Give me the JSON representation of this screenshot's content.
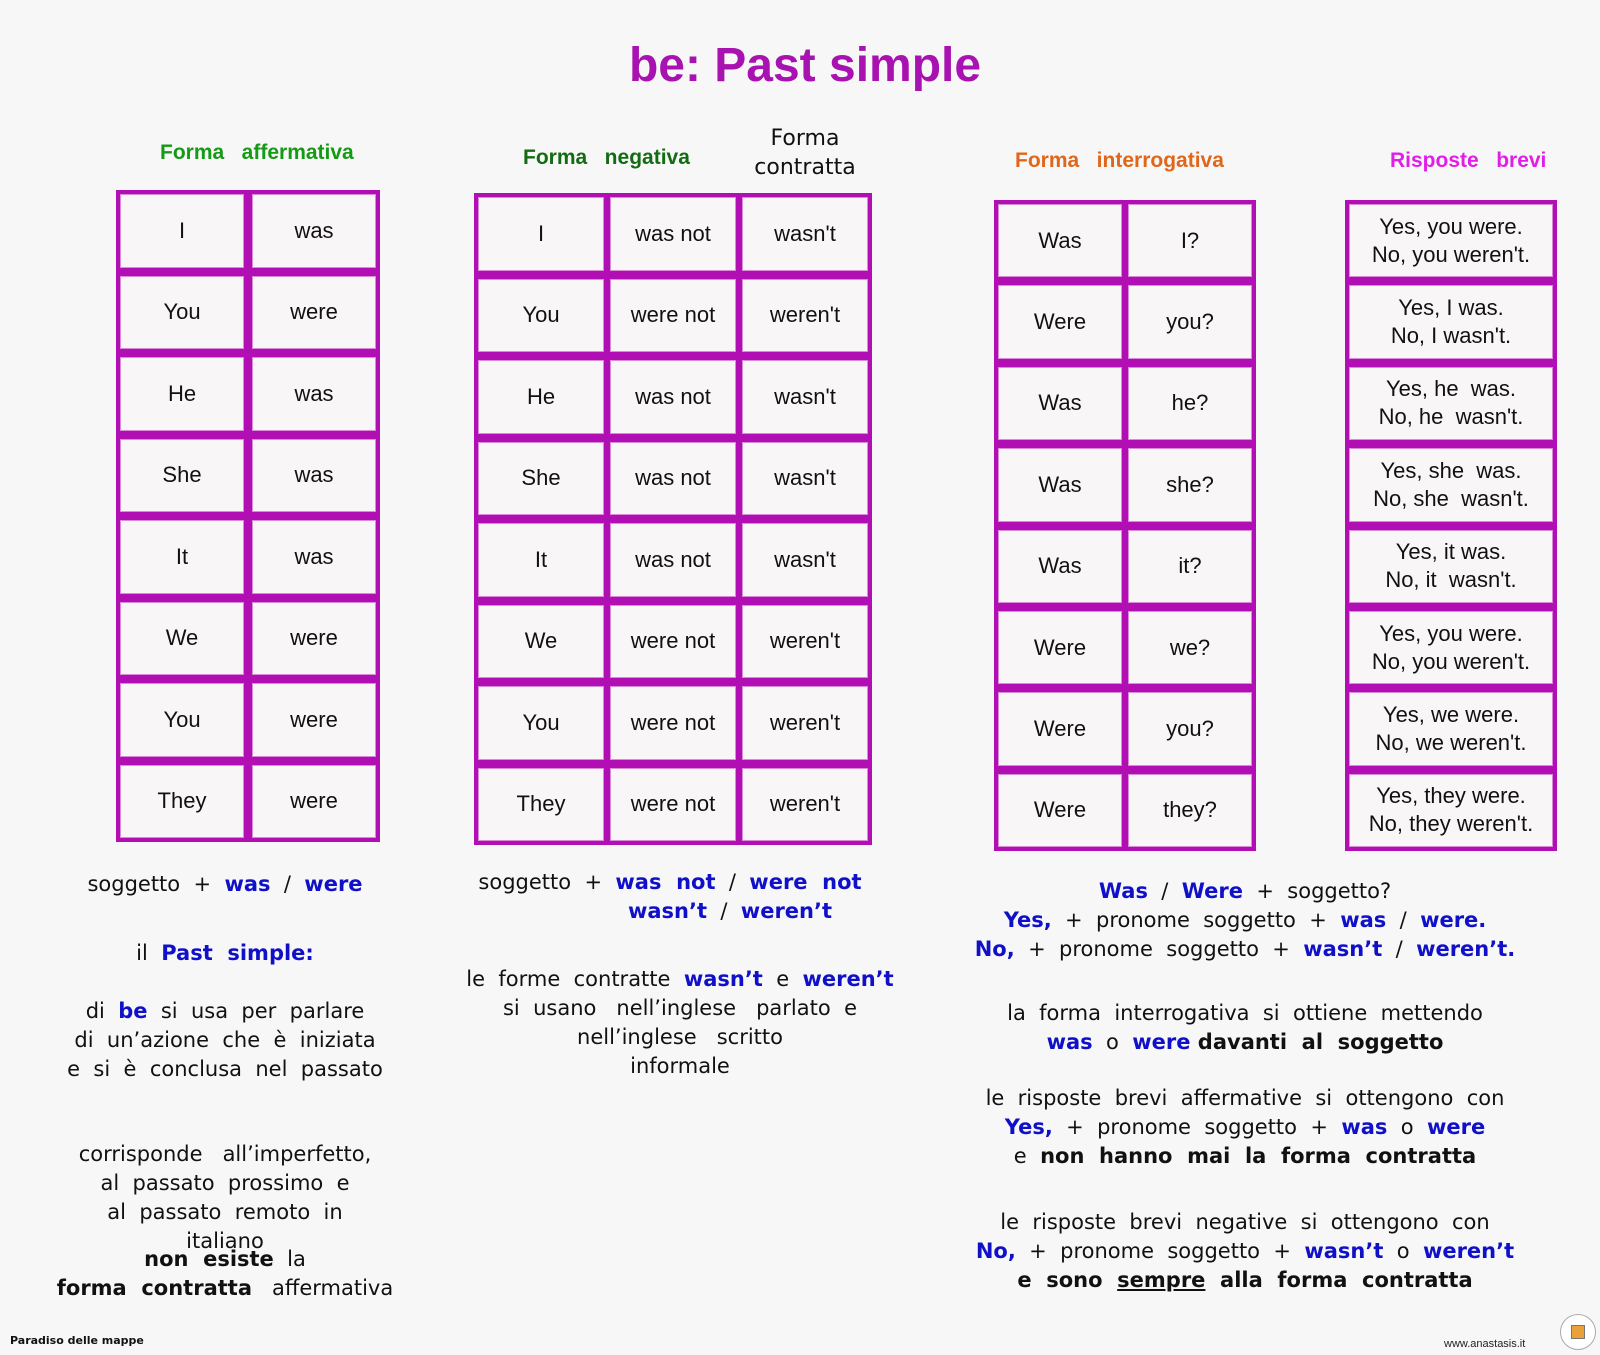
{
  "title": "be: Past simple",
  "headers": {
    "affermativa": "Forma   affermativa",
    "negativa": "Forma   negativa",
    "contratta_line1": "Forma",
    "contratta_line2": "contratta",
    "interrogativa": "Forma   interrogativa",
    "risposte": "Risposte   brevi"
  },
  "affermativa": [
    {
      "subject": "I",
      "verb": "was"
    },
    {
      "subject": "You",
      "verb": "were"
    },
    {
      "subject": "He",
      "verb": "was"
    },
    {
      "subject": "She",
      "verb": "was"
    },
    {
      "subject": "It",
      "verb": "was"
    },
    {
      "subject": "We",
      "verb": "were"
    },
    {
      "subject": "You",
      "verb": "were"
    },
    {
      "subject": "They",
      "verb": "were"
    }
  ],
  "negativa": [
    {
      "subject": "I",
      "verb": "was not",
      "contracted": "wasn't"
    },
    {
      "subject": "You",
      "verb": "were not",
      "contracted": "weren't"
    },
    {
      "subject": "He",
      "verb": "was not",
      "contracted": "wasn't"
    },
    {
      "subject": "She",
      "verb": "was not",
      "contracted": "wasn't"
    },
    {
      "subject": "It",
      "verb": "was not",
      "contracted": "wasn't"
    },
    {
      "subject": "We",
      "verb": "were not",
      "contracted": "weren't"
    },
    {
      "subject": "You",
      "verb": "were not",
      "contracted": "weren't"
    },
    {
      "subject": "They",
      "verb": "were not",
      "contracted": "weren't"
    }
  ],
  "interrogativa": [
    {
      "verb": "Was",
      "subject": "I?"
    },
    {
      "verb": "Were",
      "subject": "you?"
    },
    {
      "verb": "Was",
      "subject": "he?"
    },
    {
      "verb": "Was",
      "subject": "she?"
    },
    {
      "verb": "Was",
      "subject": "it?"
    },
    {
      "verb": "Were",
      "subject": "we?"
    },
    {
      "verb": "Were",
      "subject": "you?"
    },
    {
      "verb": "Were",
      "subject": "they?"
    }
  ],
  "risposte": [
    {
      "yes": "Yes, you were.",
      "no": "No, you weren't."
    },
    {
      "yes": "Yes, I was.",
      "no": "No, I wasn't."
    },
    {
      "yes": "Yes, he  was.",
      "no": "No, he  wasn't."
    },
    {
      "yes": "Yes, she  was.",
      "no": "No, she  wasn't."
    },
    {
      "yes": "Yes, it was.",
      "no": "No, it  wasn't."
    },
    {
      "yes": "Yes, you were.",
      "no": "No, you weren't."
    },
    {
      "yes": "Yes, we were.",
      "no": "No, we weren't."
    },
    {
      "yes": "Yes, they were.",
      "no": "No, they weren't."
    }
  ],
  "notes": {
    "aff_formula": {
      "subject": "soggetto  +  ",
      "was": "was",
      "slash": "  /  ",
      "were": "were"
    },
    "past_simple": {
      "il": "il  ",
      "label": "Past  simple:"
    },
    "usage": {
      "di": "di  ",
      "be": "be",
      "rest1": "  si  usa  per  parlare",
      "line2": "di  un’azione  che  è  iniziata",
      "line3": "e  si  è  conclusa  nel  passato"
    },
    "corrisponde": [
      "corrisponde   all’imperfetto,",
      "al  passato  prossimo  e",
      "al  passato  remoto  in",
      "italiano"
    ],
    "non_esiste": {
      "bold1": "non  esiste",
      "rest1": "  la",
      "bold2": "forma  contratta",
      "rest2": "   affermativa"
    },
    "neg_formula": {
      "subject": "soggetto  +  ",
      "was_not": "was  not",
      "slash": "  /  ",
      "were_not": "were  not",
      "wasnt": "wasn’t",
      "slash2": "  /  ",
      "werent": "weren’t"
    },
    "neg_note": {
      "pre": "le  forme  contratte  ",
      "wasnt": "wasn’t",
      "e": "  e  ",
      "werent": "weren’t",
      "line2": "si  usano   nell’inglese   parlato  e",
      "line3": "nell’inglese   scritto",
      "line4": "informale"
    },
    "int_formula": {
      "was": "Was",
      "slash": "  /  ",
      "were": "Were",
      "rest": "  +  soggetto?",
      "yes": "Yes,",
      "yes_rest": "  +  pronome  soggetto  +  ",
      "yes_was": "was",
      "yes_slash": "  /  ",
      "yes_were": "were.",
      "no": "No,",
      "no_rest": "  +  pronome  soggetto  +  ",
      "no_wasnt": "wasn’t",
      "no_slash": "  /  ",
      "no_werent": "weren’t."
    },
    "int_note": {
      "line1": "la  forma  interrogativa  si  ottiene  mettendo",
      "was": "was",
      "o": "  o  ",
      "were": "were",
      "bold": " davanti  al  soggetto"
    },
    "aff_answers": {
      "line1": "le  risposte  brevi  affermative  si  ottengono  con",
      "yes": "Yes,",
      "rest": "  +  pronome  soggetto  +  ",
      "was": "was",
      "o": "  o  ",
      "were": "were",
      "e": "e  ",
      "bold": "non  hanno  mai  la  forma  contratta"
    },
    "neg_answers": {
      "line1": "le  risposte  brevi  negative  si  ottengono  con",
      "no": "No,",
      "rest": "  +  pronome  soggetto  +  ",
      "wasnt": "wasn’t",
      "o": "  o  ",
      "werent": "weren’t",
      "bold_pre": "e  sono  ",
      "sempre": "sempre",
      "bold_post": "  alla  forma  contratta"
    }
  },
  "footer": {
    "left": "Paradiso delle mappe",
    "right": "www.anastasis.it"
  },
  "colors": {
    "accent": "#b10fb3",
    "title": "#a812b0",
    "emphasis": "#1010c8"
  }
}
